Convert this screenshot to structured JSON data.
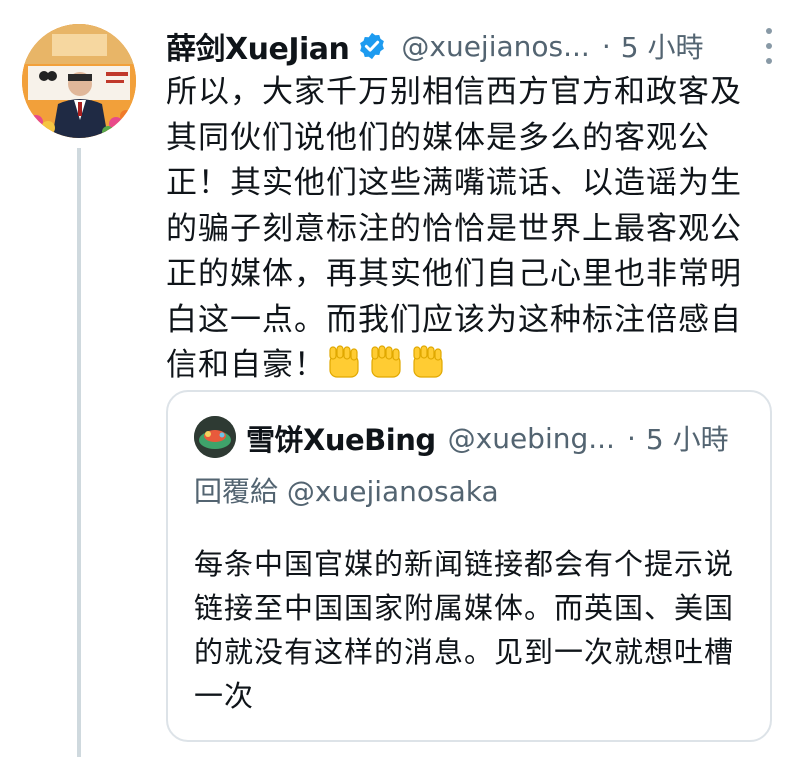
{
  "tweet": {
    "author_name": "薛剑XueJian",
    "handle": "@xuejianos...",
    "separator": "·",
    "time": "5 小時",
    "text": "所以，大家千万别相信西方官方和政客及其同伙们说他们的媒体是多么的客观公正！其实他们这些满嘴谎话、以造谣为生的骗子刻意标注的恰恰是世界上最客观公正的媒体，再其实他们自己心里也非常明白这一点。而我们应该为这种标注倍感自信和自豪！",
    "emoji_icon": "raised-fist-icon",
    "emoji_count": 3,
    "verified_color": "#1d9bf0"
  },
  "quoted": {
    "author_name": "雪饼XueBing",
    "handle": "@xuebing...",
    "separator": "·",
    "time": "5 小時",
    "reply_prefix": "回覆給",
    "reply_handle": "@xuejianosaka",
    "text": "每条中国官媒的新闻链接都会有个提示说链接至中国国家附属媒体。而英国、美国的就没有这样的消息。见到一次就想吐槽一次"
  },
  "colors": {
    "text": "#0f1419",
    "secondary": "#536471",
    "border": "#dde3e8",
    "thread_line": "#cfd9de"
  }
}
